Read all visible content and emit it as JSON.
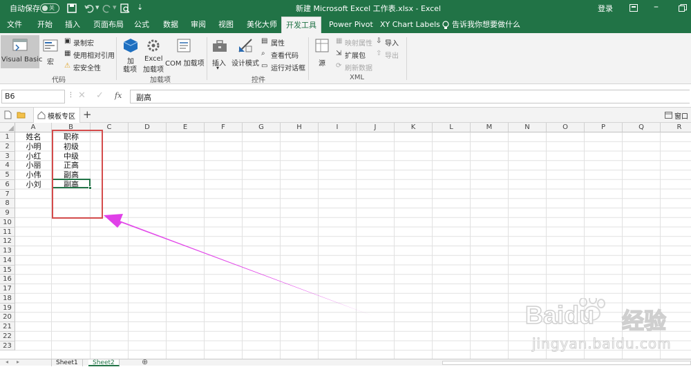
{
  "titlebar": {
    "autosave_label": "自动保存",
    "autosave_state": "关",
    "title": "新建 Microsoft Excel 工作表.xlsx  -  Excel",
    "login": "登录"
  },
  "menu": {
    "tabs": [
      "文件",
      "开始",
      "插入",
      "页面布局",
      "公式",
      "数据",
      "审阅",
      "视图",
      "美化大师",
      "开发工具",
      "Power Pivot",
      "XY Chart Labels"
    ],
    "active": "开发工具",
    "tell_me": "告诉我你想要做什么"
  },
  "ribbon": {
    "code": {
      "group_label": "代码",
      "visual_basic": "Visual Basic",
      "macros": "宏",
      "record_macro": "录制宏",
      "relative_ref": "使用相对引用",
      "macro_security": "宏安全性"
    },
    "addins": {
      "group_label": "加载项",
      "addins": "加\n载项",
      "excel_addins_1": "Excel",
      "excel_addins_2": "加载项",
      "com_addins": "COM 加载项"
    },
    "controls": {
      "group_label": "控件",
      "insert": "插入",
      "design_mode": "设计模式",
      "properties": "属性",
      "view_code": "查看代码",
      "run_dialog": "运行对话框"
    },
    "xml": {
      "group_label": "XML",
      "source": "源",
      "map_properties": "映射属性",
      "expansion_packs": "扩展包",
      "refresh_data": "刷新数据",
      "import": "导入",
      "export": "导出"
    }
  },
  "formula_bar": {
    "name_box": "B6",
    "fx": "fx",
    "value": "副高"
  },
  "tabstrip": {
    "template_zone": "模板专区",
    "window": "窗口"
  },
  "sheet": {
    "columns": [
      "A",
      "B",
      "C",
      "D",
      "E",
      "F",
      "G",
      "H",
      "I",
      "J",
      "K",
      "L",
      "M",
      "N",
      "O",
      "P",
      "Q",
      "R"
    ],
    "rows": [
      "1",
      "2",
      "3",
      "4",
      "5",
      "6",
      "7",
      "8",
      "9",
      "10",
      "11",
      "12",
      "13",
      "14",
      "15",
      "16",
      "17",
      "18",
      "19",
      "20",
      "21",
      "22",
      "23"
    ],
    "cells": [
      [
        "姓名",
        "职称"
      ],
      [
        "小明",
        "初级"
      ],
      [
        "小红",
        "中级"
      ],
      [
        "小丽",
        "正高"
      ],
      [
        "小伟",
        "副高"
      ],
      [
        "小刘",
        "副高"
      ]
    ],
    "selected_cell": "B6"
  },
  "sheets": [
    "Sheet1",
    "Sheet2"
  ],
  "active_sheet": "Sheet2",
  "watermark": {
    "brand": "Baidu",
    "brand_cn": "经验",
    "url": "jingyan.baidu.com"
  },
  "colors": {
    "excel_green": "#217346",
    "annotation_red": "#d44b4b",
    "arrow_magenta": "#e040e8"
  }
}
